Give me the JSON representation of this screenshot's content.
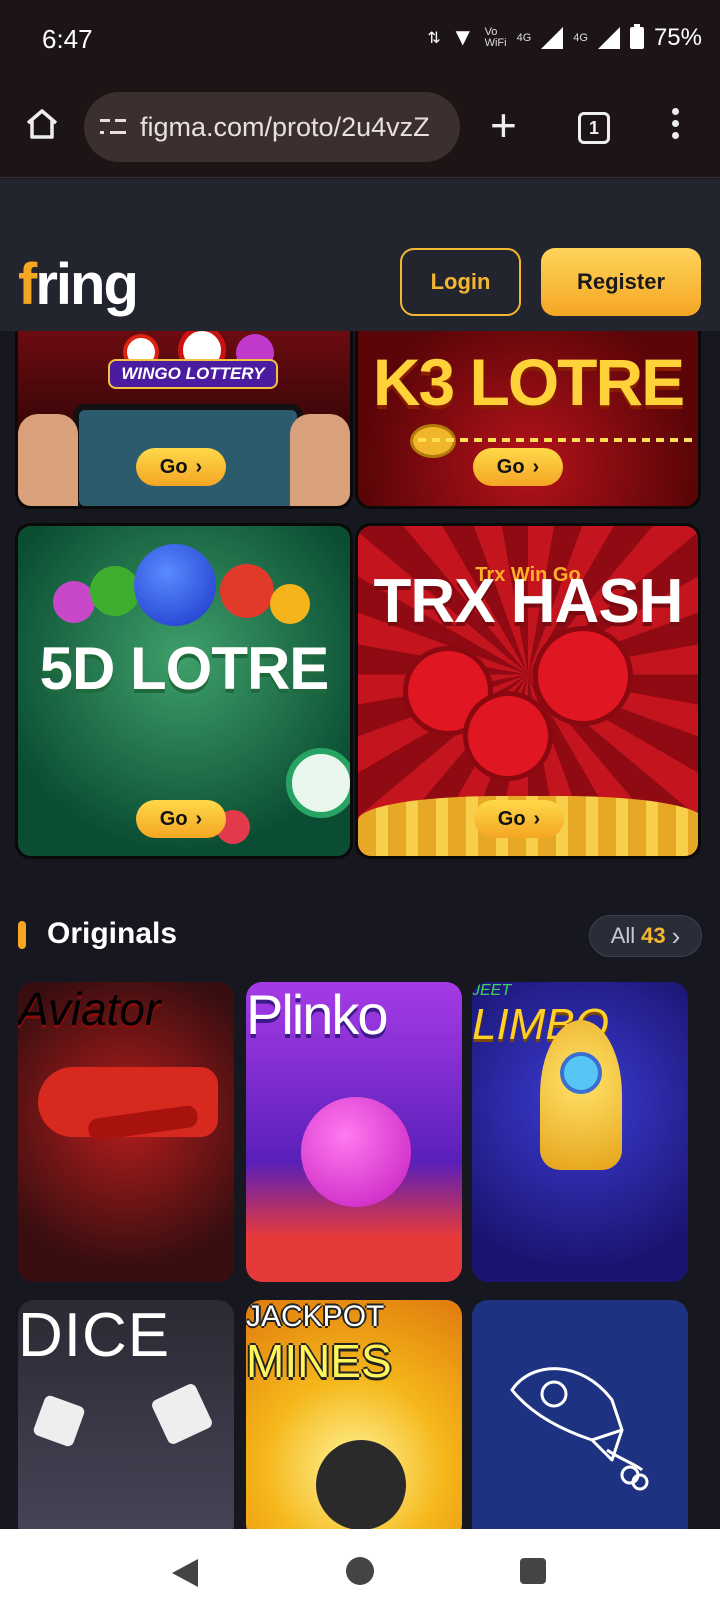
{
  "status": {
    "time": "6:47",
    "network_left": "Vo WiFi",
    "net1": "4G",
    "net2": "4G",
    "battery": "75%"
  },
  "browser": {
    "url": "figma.com/proto/2u4vzZ",
    "tab_count": "1"
  },
  "header": {
    "logo": "ring",
    "login_label": "Login",
    "register_label": "Register"
  },
  "lottery": [
    {
      "title": "WINGO LOTTERY",
      "go": "Go"
    },
    {
      "title": "K3 LOTRE",
      "go": "Go"
    },
    {
      "title": "5D LOTRE",
      "go": "Go"
    },
    {
      "title": "TRX HASH",
      "subtitle": "Trx Win Go",
      "go": "Go"
    }
  ],
  "originals": {
    "title": "Originals",
    "all_label": "All",
    "all_count": "43"
  },
  "games": [
    {
      "title": "Aviator"
    },
    {
      "title": "Plinko"
    },
    {
      "title": "LIMBO",
      "brand": "JEET"
    },
    {
      "title": "DICE"
    },
    {
      "title": "JACKPOT",
      "subtitle": "MINES"
    },
    {
      "title": ""
    }
  ]
}
